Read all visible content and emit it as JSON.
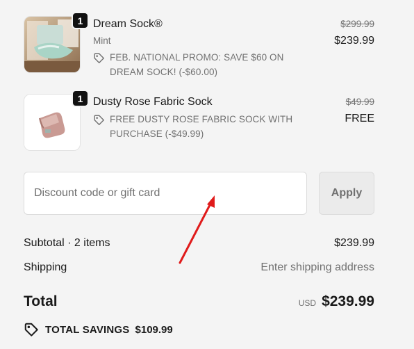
{
  "items": [
    {
      "name": "Dream Sock®",
      "variant": "Mint",
      "quantity": "1",
      "promo": "FEB. NATIONAL PROMO: SAVE $60 ON DREAM SOCK! (-$60.00)",
      "compare_price": "$299.99",
      "price": "$239.99"
    },
    {
      "name": "Dusty Rose Fabric Sock",
      "quantity": "1",
      "promo": "FREE DUSTY ROSE FABRIC SOCK WITH PURCHASE (-$49.99)",
      "compare_price": "$49.99",
      "price": "FREE"
    }
  ],
  "discount": {
    "placeholder": "Discount code or gift card",
    "apply_label": "Apply"
  },
  "summary": {
    "subtotal_label": "Subtotal · 2 items",
    "subtotal_value": "$239.99",
    "shipping_label": "Shipping",
    "shipping_value": "Enter shipping address",
    "total_label": "Total",
    "currency": "USD",
    "total_value": "$239.99",
    "savings_label": "TOTAL SAVINGS",
    "savings_value": "$109.99"
  },
  "colors": {
    "background": "#f4f4f4",
    "text": "#1a1a1a",
    "muted_text": "#707070",
    "annotation_arrow": "#e01b1b"
  },
  "icons": [
    "tag-icon",
    "red-annotation-arrow"
  ]
}
